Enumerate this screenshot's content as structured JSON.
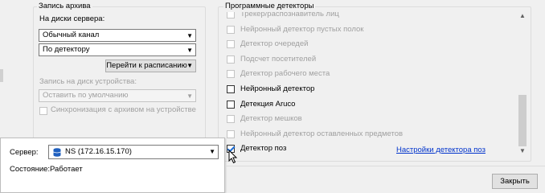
{
  "archive_group": {
    "title": "Запись архива",
    "server_disks_label": "На диски сервера:",
    "channel_select": "Обычный канал",
    "mode_select": "По детектору",
    "goto_schedule_button": "Перейти к расписанию",
    "device_disk_label": "Запись на диск устройства:",
    "device_default_select": "Оставить по умолчанию",
    "sync_checkbox_label": "Синхронизация с архивом на устройстве"
  },
  "detectors_group": {
    "title": "Программные детекторы",
    "partial_top_label": "Трекер/распознавитель лиц",
    "items": [
      {
        "label": "Нейронный детектор пустых полок",
        "enabled": false,
        "checked": false
      },
      {
        "label": "Детектор очередей",
        "enabled": false,
        "checked": false
      },
      {
        "label": "Подсчет посетителей",
        "enabled": false,
        "checked": false
      },
      {
        "label": "Детектор рабочего места",
        "enabled": false,
        "checked": false
      },
      {
        "label": "Нейронный детектор",
        "enabled": true,
        "checked": false
      },
      {
        "label": "Детекция Aruco",
        "enabled": true,
        "checked": false
      },
      {
        "label": "Детектор мешков",
        "enabled": false,
        "checked": false
      },
      {
        "label": "Нейронный детектор оставленных предметов",
        "enabled": false,
        "checked": false
      },
      {
        "label": "Детектор поз",
        "enabled": true,
        "checked": true
      }
    ],
    "settings_link": "Настройки детектора поз"
  },
  "server_popup": {
    "server_label": "Сервер:",
    "server_value": "NS (172.16.15.170)",
    "status_label": "Состояние:",
    "status_value": "Работает"
  },
  "footer": {
    "close_button": "Закрыть"
  }
}
